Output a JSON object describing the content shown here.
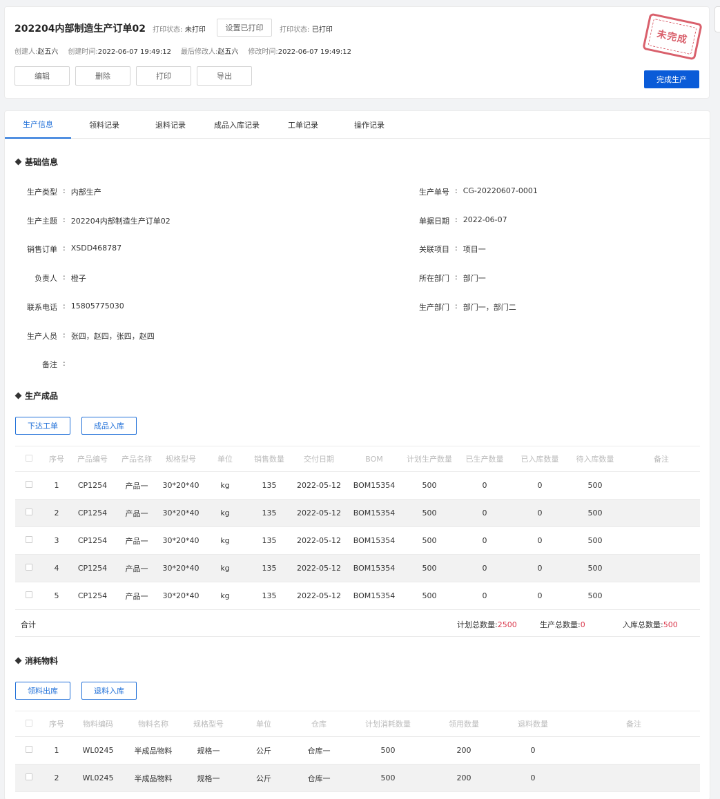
{
  "header": {
    "title": "202204内部制造生产订单02",
    "print_status_label_1": "打印状态:",
    "print_status_value_1": "未打印",
    "set_printed_button": "设置已打印",
    "print_status_label_2": "打印状态:",
    "print_status_value_2": "已打印",
    "creator_label": "创建人:",
    "creator": "赵五六",
    "created_time_label": "创建时间:",
    "created_time": "2022-06-07 19:49:12",
    "modifier_label": "最后修改人:",
    "modifier": "赵五六",
    "modified_time_label": "修改时间:",
    "modified_time": "2022-06-07 19:49:12",
    "actions": [
      "编辑",
      "删除",
      "打印",
      "导出"
    ],
    "complete_button": "完成生产",
    "stamp_text": "未完成",
    "stamp_color": "#d9606c",
    "accent_color": "#0a5bd8"
  },
  "tabs": [
    "生产信息",
    "领料记录",
    "退料记录",
    "成品入库记录",
    "工单记录",
    "操作记录"
  ],
  "active_tab": 0,
  "basic_info": {
    "title": "基础信息",
    "left": [
      {
        "label": "生产类型",
        "value": "内部生产"
      },
      {
        "label": "生产主题",
        "value": "202204内部制造生产订单02"
      },
      {
        "label": "销售订单",
        "value": "XSDD468787"
      },
      {
        "label": "负责人",
        "value": "橙子"
      },
      {
        "label": "联系电话",
        "value": "15805775030"
      },
      {
        "label": "生产人员",
        "value": "张四，赵四，张四，赵四"
      },
      {
        "label": "备注",
        "value": ""
      }
    ],
    "right": [
      {
        "label": "生产单号",
        "value": "CG-20220607-0001"
      },
      {
        "label": "单据日期",
        "value": "2022-06-07"
      },
      {
        "label": "关联项目",
        "value": "项目一"
      },
      {
        "label": "所在部门",
        "value": "部门一"
      },
      {
        "label": "生产部门",
        "value": "部门一，部门二"
      }
    ],
    "separator": ":"
  },
  "products": {
    "title": "生产成品",
    "buttons": [
      "下达工单",
      "成品入库"
    ],
    "columns": [
      "序号",
      "产品编号",
      "产品名称",
      "规格型号",
      "单位",
      "销售数量",
      "交付日期",
      "BOM",
      "计划生产数量",
      "已生产数量",
      "已入库数量",
      "待入库数量",
      "备注"
    ],
    "rows": [
      [
        "1",
        "CP1254",
        "产品一",
        "30*20*40",
        "kg",
        "135",
        "2022-05-12",
        "BOM15354",
        "500",
        "0",
        "0",
        "500",
        ""
      ],
      [
        "2",
        "CP1254",
        "产品一",
        "30*20*40",
        "kg",
        "135",
        "2022-05-12",
        "BOM15354",
        "500",
        "0",
        "0",
        "500",
        ""
      ],
      [
        "3",
        "CP1254",
        "产品一",
        "30*20*40",
        "kg",
        "135",
        "2022-05-12",
        "BOM15354",
        "500",
        "0",
        "0",
        "500",
        ""
      ],
      [
        "4",
        "CP1254",
        "产品一",
        "30*20*40",
        "kg",
        "135",
        "2022-05-12",
        "BOM15354",
        "500",
        "0",
        "0",
        "500",
        ""
      ],
      [
        "5",
        "CP1254",
        "产品一",
        "30*20*40",
        "kg",
        "135",
        "2022-05-12",
        "BOM15354",
        "500",
        "0",
        "0",
        "500",
        ""
      ]
    ],
    "summary": {
      "label": "合计",
      "plan_label": "计划总数量:",
      "plan_value": "2500",
      "produced_label": "生产总数量:",
      "produced_value": "0",
      "stored_label": "入库总数量:",
      "stored_value": "500"
    }
  },
  "materials": {
    "title": "消耗物料",
    "buttons": [
      "领料出库",
      "退料入库"
    ],
    "columns": [
      "序号",
      "物料编码",
      "物料名称",
      "规格型号",
      "单位",
      "仓库",
      "计划消耗数量",
      "领用数量",
      "退料数量",
      "备注"
    ],
    "rows": [
      [
        "1",
        "WL0245",
        "半成品物料",
        "规格一",
        "公斤",
        "仓库一",
        "500",
        "200",
        "0",
        ""
      ],
      [
        "2",
        "WL0245",
        "半成品物料",
        "规格一",
        "公斤",
        "仓库一",
        "500",
        "200",
        "0",
        ""
      ]
    ]
  }
}
